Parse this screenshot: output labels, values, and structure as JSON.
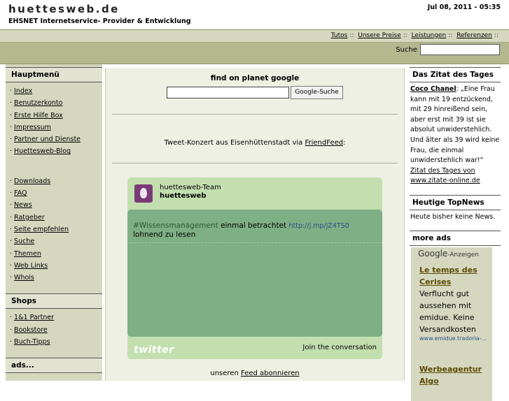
{
  "site": {
    "title": "huettesweb.de",
    "subtitle": "EHSNET Internetservice- Provider & Entwicklung",
    "datetime": "Jul 08, 2011 - 05:35"
  },
  "nav": {
    "links": [
      "Tutos",
      "Unsere Preise",
      "Leistungen",
      "Referenzen"
    ],
    "search_label": "Suche"
  },
  "left": {
    "main_title": "Hauptmenü",
    "main_items": [
      "Index",
      "Benutzerkonto",
      "Erste Hilfe Box",
      "Impressum",
      "Partner und Dienste",
      "Huettesweb-Blog"
    ],
    "more_items": [
      "Downloads",
      "FAQ",
      "News",
      "Ratgeber",
      "Seite empfehlen",
      "Suche",
      "Themen",
      "Web Links",
      "Whois"
    ],
    "shops_title": "Shops",
    "shop_items": [
      "1&1 Partner",
      "Bookstore",
      "Buch-Tipps"
    ],
    "ads_title": "ads..."
  },
  "center": {
    "google_title": "find on planet google",
    "google_button": "Google-Suche",
    "tweet_prefix": "Tweet-Konzert aus Eisenhüttenstadt via ",
    "tweet_link": "FriendFeed",
    "tweet_suffix": ":",
    "widget": {
      "name": "huettesweb-Team",
      "handle": "huettesweb",
      "hashtag": "#Wissensmanagement",
      "text_mid": " einmal betrachtet ",
      "url": "http://j.mp/jZ4TS0",
      "text_end": " lohnend zu lesen",
      "logo": "twitter",
      "join": "Join the conversation"
    },
    "feed_prefix": "unseren ",
    "feed_link": "Feed abonnieren"
  },
  "right": {
    "quote_title": "Das Zitat des Tages",
    "quote_author": "Coco Chanel",
    "quote_text": ": „Eine Frau kann mit 19 entzückend, mit 29 hinreißend sein, aber erst mit 39 ist sie absolut unwiderstehlich. Und älter als 39 wird keine Frau, die einmal unwiderstehlich war!“",
    "quote_link": "Zitat des Tages von www.zitate-online.de",
    "topnews_title": "Heutige TopNews",
    "topnews_text": "Heute bisher keine News.",
    "ads_title": "more ads",
    "google_brand": "Google",
    "google_ads": "-Anzeigen",
    "ad1_title_1": "Le temps des",
    "ad1_title_2": "Cerises",
    "ad1_lines": [
      "Verflucht gut",
      "aussehen mit",
      "emidue. Keine",
      "Versandkosten"
    ],
    "ad1_url": "www.emidue.tradoria-...",
    "ad2_title_1": "Werbeagentur",
    "ad2_title_2": "Algo"
  }
}
